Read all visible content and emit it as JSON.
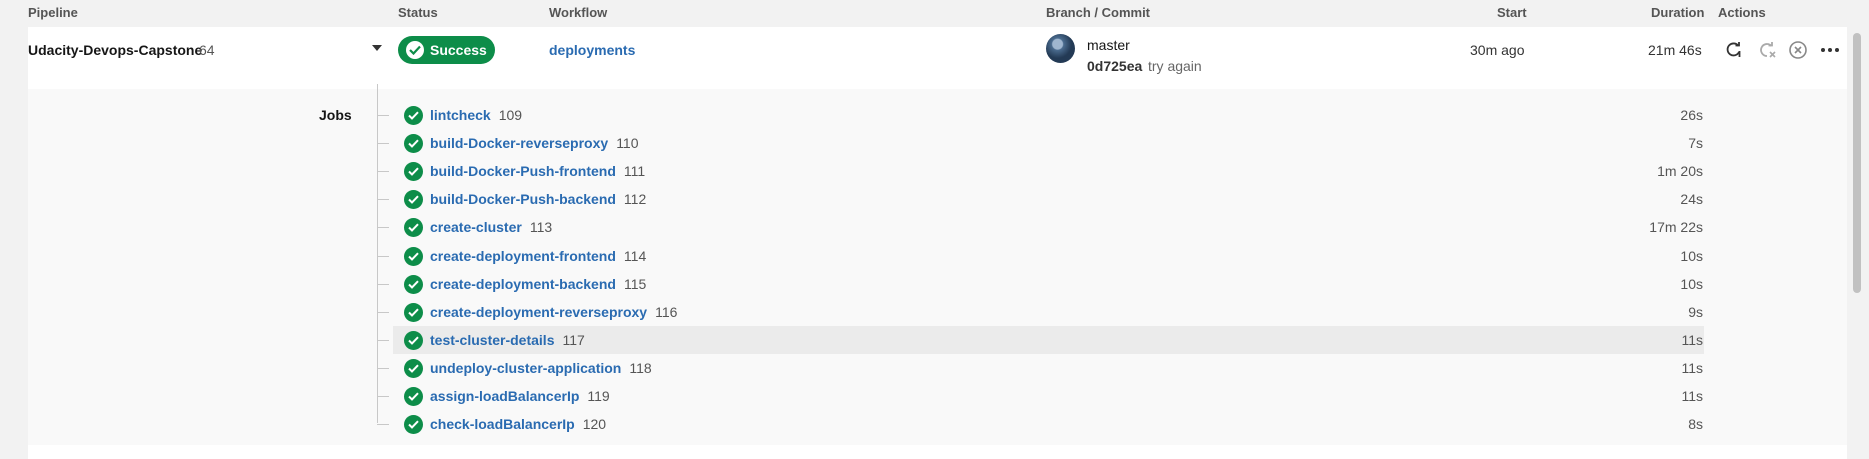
{
  "header": {
    "pipeline": "Pipeline",
    "status": "Status",
    "workflow": "Workflow",
    "branch_commit": "Branch / Commit",
    "start": "Start",
    "duration": "Duration",
    "actions": "Actions"
  },
  "pipeline": {
    "name": "Udacity-Devops-Capstone",
    "number": "64",
    "status": "Success",
    "workflow": "deployments",
    "branch": "master",
    "commit_hash": "0d725ea",
    "commit_message": "try again",
    "start": "30m ago",
    "duration": "21m 46s"
  },
  "jobs_label": "Jobs",
  "jobs": [
    {
      "name": "lintcheck",
      "number": "109",
      "duration": "26s"
    },
    {
      "name": "build-Docker-reverseproxy",
      "number": "110",
      "duration": "7s"
    },
    {
      "name": "build-Docker-Push-frontend",
      "number": "111",
      "duration": "1m 20s"
    },
    {
      "name": "build-Docker-Push-backend",
      "number": "112",
      "duration": "24s"
    },
    {
      "name": "create-cluster",
      "number": "113",
      "duration": "17m 22s"
    },
    {
      "name": "create-deployment-frontend",
      "number": "114",
      "duration": "10s"
    },
    {
      "name": "create-deployment-backend",
      "number": "115",
      "duration": "10s"
    },
    {
      "name": "create-deployment-reverseproxy",
      "number": "116",
      "duration": "9s"
    },
    {
      "name": "test-cluster-details",
      "number": "117",
      "duration": "11s"
    },
    {
      "name": "undeploy-cluster-application",
      "number": "118",
      "duration": "11s"
    },
    {
      "name": "assign-loadBalancerIp",
      "number": "119",
      "duration": "11s"
    },
    {
      "name": "check-loadBalancerIp",
      "number": "120",
      "duration": "8s"
    }
  ],
  "colors": {
    "success": "#0d8d49",
    "link": "#2a6bb1"
  },
  "icons": {
    "status": "check-icon",
    "rerun": "rerun-icon",
    "rerun_failed": "rerun-failed-icon",
    "cancel": "cancel-icon",
    "more": "more-icon"
  }
}
